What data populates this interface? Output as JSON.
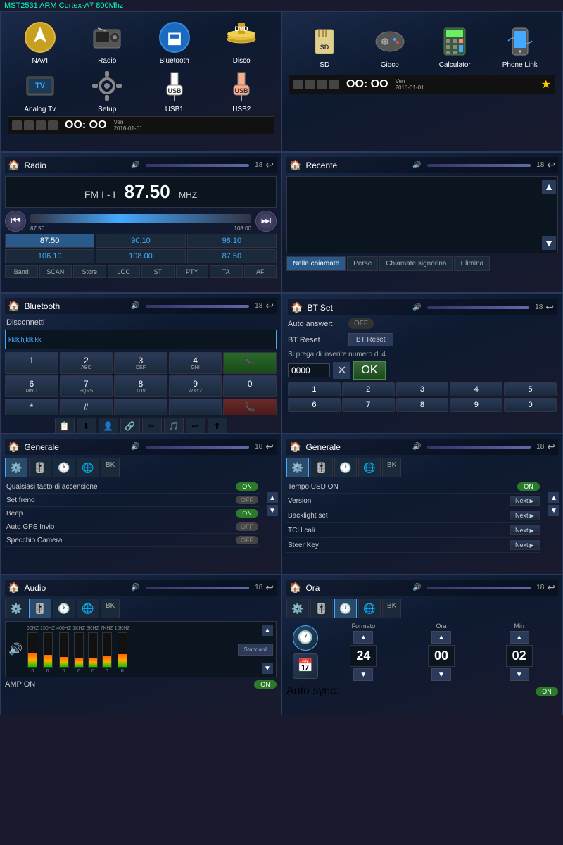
{
  "topBar": {
    "title": "MST2531 ARM Cortex-A7 800Mhz",
    "color": "#00ffcc"
  },
  "homeScreen1": {
    "apps": [
      {
        "icon": "🧭",
        "label": "NAVI"
      },
      {
        "icon": "📻",
        "label": "Radio"
      },
      {
        "icon": "🎧",
        "label": "Bluetooth"
      },
      {
        "icon": "💿",
        "label": "Disco"
      },
      {
        "icon": "📺",
        "label": "Analog Tv"
      },
      {
        "icon": "⚙️",
        "label": "Setup"
      },
      {
        "icon": "💾",
        "label": "USB1"
      },
      {
        "icon": "💾",
        "label": "USB2"
      }
    ],
    "time": "OO: OO",
    "date": "Ven\n2016-01-01"
  },
  "homeScreen2": {
    "apps": [
      {
        "icon": "💳",
        "label": "SD"
      },
      {
        "icon": "🎮",
        "label": "Gioco"
      },
      {
        "icon": "🧮",
        "label": "Calculator"
      },
      {
        "icon": "📱",
        "label": "Phone Link"
      }
    ],
    "time": "OO: OO",
    "date": "Ven\n2016-01-01",
    "starIcon": "★"
  },
  "radio": {
    "title": "Radio",
    "band": "FM I - I",
    "freq": "87.50",
    "unit": "MHZ",
    "sliderMin": "87.50",
    "sliderMax": "108.00",
    "presets": [
      "87.50",
      "90.10",
      "98.10",
      "106.10",
      "108.00",
      "87.50"
    ],
    "funcs": [
      "Band",
      "SCAN",
      "Store",
      "LOC",
      "ST",
      "PTY",
      "TA",
      "AF"
    ]
  },
  "recente": {
    "title": "Recente",
    "tabs": [
      "Nelle chiamate",
      "Perse",
      "Chiamate signorina",
      "Elimina"
    ]
  },
  "bluetooth": {
    "title": "Bluetooth",
    "disconnectLabel": "Disconnetti",
    "deviceName": "kklkjhjklklkkl",
    "numpad": [
      [
        "1",
        "",
        ""
      ],
      [
        "2",
        "ABC",
        ""
      ],
      [
        "3",
        "DEF",
        ""
      ],
      [
        "4",
        "GHI",
        ""
      ],
      [
        "📞",
        "",
        "call-green"
      ],
      [
        "6",
        "MNO",
        ""
      ],
      [
        "7",
        "PQRS",
        ""
      ],
      [
        "8",
        "TUV",
        ""
      ],
      [
        "9",
        "WXYZ",
        ""
      ],
      [
        "0",
        "#",
        ""
      ],
      [
        "*",
        "",
        ""
      ],
      [
        "#",
        "",
        ""
      ],
      [
        "📞",
        "",
        "call-red"
      ]
    ],
    "numpadRows": [
      [
        {
          "n": "1",
          "s": ""
        },
        {
          "n": "2",
          "s": "ABC"
        },
        {
          "n": "3",
          "s": "DEF"
        },
        {
          "n": "4",
          "s": "GHI"
        },
        {
          "n": "📞",
          "s": "",
          "c": "green"
        }
      ],
      [
        {
          "n": "6",
          "s": "MNO"
        },
        {
          "n": "7",
          "s": "PQRS"
        },
        {
          "n": "8",
          "s": "TUV"
        },
        {
          "n": "9",
          "s": "WXYZ"
        },
        {
          "n": "0",
          "s": "",
          "c": ""
        }
      ],
      [
        {
          "n": "*",
          "s": ""
        },
        {
          "n": "#",
          "s": ""
        },
        {
          "n": "",
          "s": ""
        },
        {
          "n": "",
          "s": ""
        },
        {
          "n": "📞",
          "s": "",
          "c": "red"
        }
      ]
    ]
  },
  "btSet": {
    "title": "BT Set",
    "autoAnswerLabel": "Auto answer:",
    "autoAnswerValue": "OFF",
    "btResetLabel": "BT Reset",
    "btResetBtn": "BT Reset",
    "hintText": "Si prega di inserire numero di 4",
    "pinValue": "0000",
    "okBtn": "OK",
    "numRow1": [
      "1",
      "2",
      "3",
      "4",
      "5"
    ],
    "numRow2": [
      "6",
      "7",
      "8",
      "9",
      "0"
    ]
  },
  "generale1": {
    "title": "Generale",
    "iconTabs": [
      "⚙️",
      "🎚️",
      "🕐",
      "🌐",
      "BK"
    ],
    "settings": [
      {
        "label": "Qualsiasi tasto di accensione",
        "value": "ON",
        "state": "on"
      },
      {
        "label": "Set freno",
        "value": "OFF",
        "state": "off"
      },
      {
        "label": "Beep",
        "value": "ON",
        "state": "on"
      },
      {
        "label": "Auto GPS Invio",
        "value": "OFF",
        "state": "off"
      },
      {
        "label": "Specchio Camera",
        "value": "",
        "state": "off"
      }
    ]
  },
  "generale2": {
    "title": "Generale",
    "iconTabs": [
      "⚙️",
      "🎚️",
      "🕐",
      "🌐",
      "BK"
    ],
    "settings": [
      {
        "label": "Tempo USD ON",
        "value": "ON",
        "state": "on"
      },
      {
        "label": "Version",
        "value": "Next",
        "state": "next"
      },
      {
        "label": "Backlight set",
        "value": "Next",
        "state": "next"
      },
      {
        "label": "TCH cali",
        "value": "Next",
        "state": "next"
      },
      {
        "label": "Steer Key",
        "value": "Next",
        "state": "next"
      }
    ]
  },
  "audio": {
    "title": "Audio",
    "iconTabs": [
      "⚙️",
      "🎚️",
      "🕐",
      "🌐",
      "BK"
    ],
    "eqBands": [
      "60HZ",
      "150HZ",
      "400HZ",
      "1KHZ",
      "3KHZ",
      "7KHZ",
      "15KHZ"
    ],
    "eqValues": [
      0,
      0,
      0,
      0,
      0,
      0,
      0
    ],
    "eqHeights": [
      40,
      35,
      30,
      25,
      28,
      32,
      38
    ],
    "presetLabel": "Standard",
    "ampOnLabel": "AMP ON",
    "ampOnState": "ON"
  },
  "ora": {
    "title": "Ora",
    "iconTabs": [
      "⚙️",
      "🎚️",
      "🕐",
      "🌐",
      "BK"
    ],
    "formatoLabel": "Formato",
    "oraLabel": "Ora",
    "minLabel": "Min",
    "formatoValue": "24",
    "oraValue": "00",
    "minValue": "02",
    "autoSyncLabel": "Auto sync:",
    "autoSyncState": "ON"
  },
  "labels": {
    "nextBtn": "Next",
    "chevron": "▶"
  }
}
